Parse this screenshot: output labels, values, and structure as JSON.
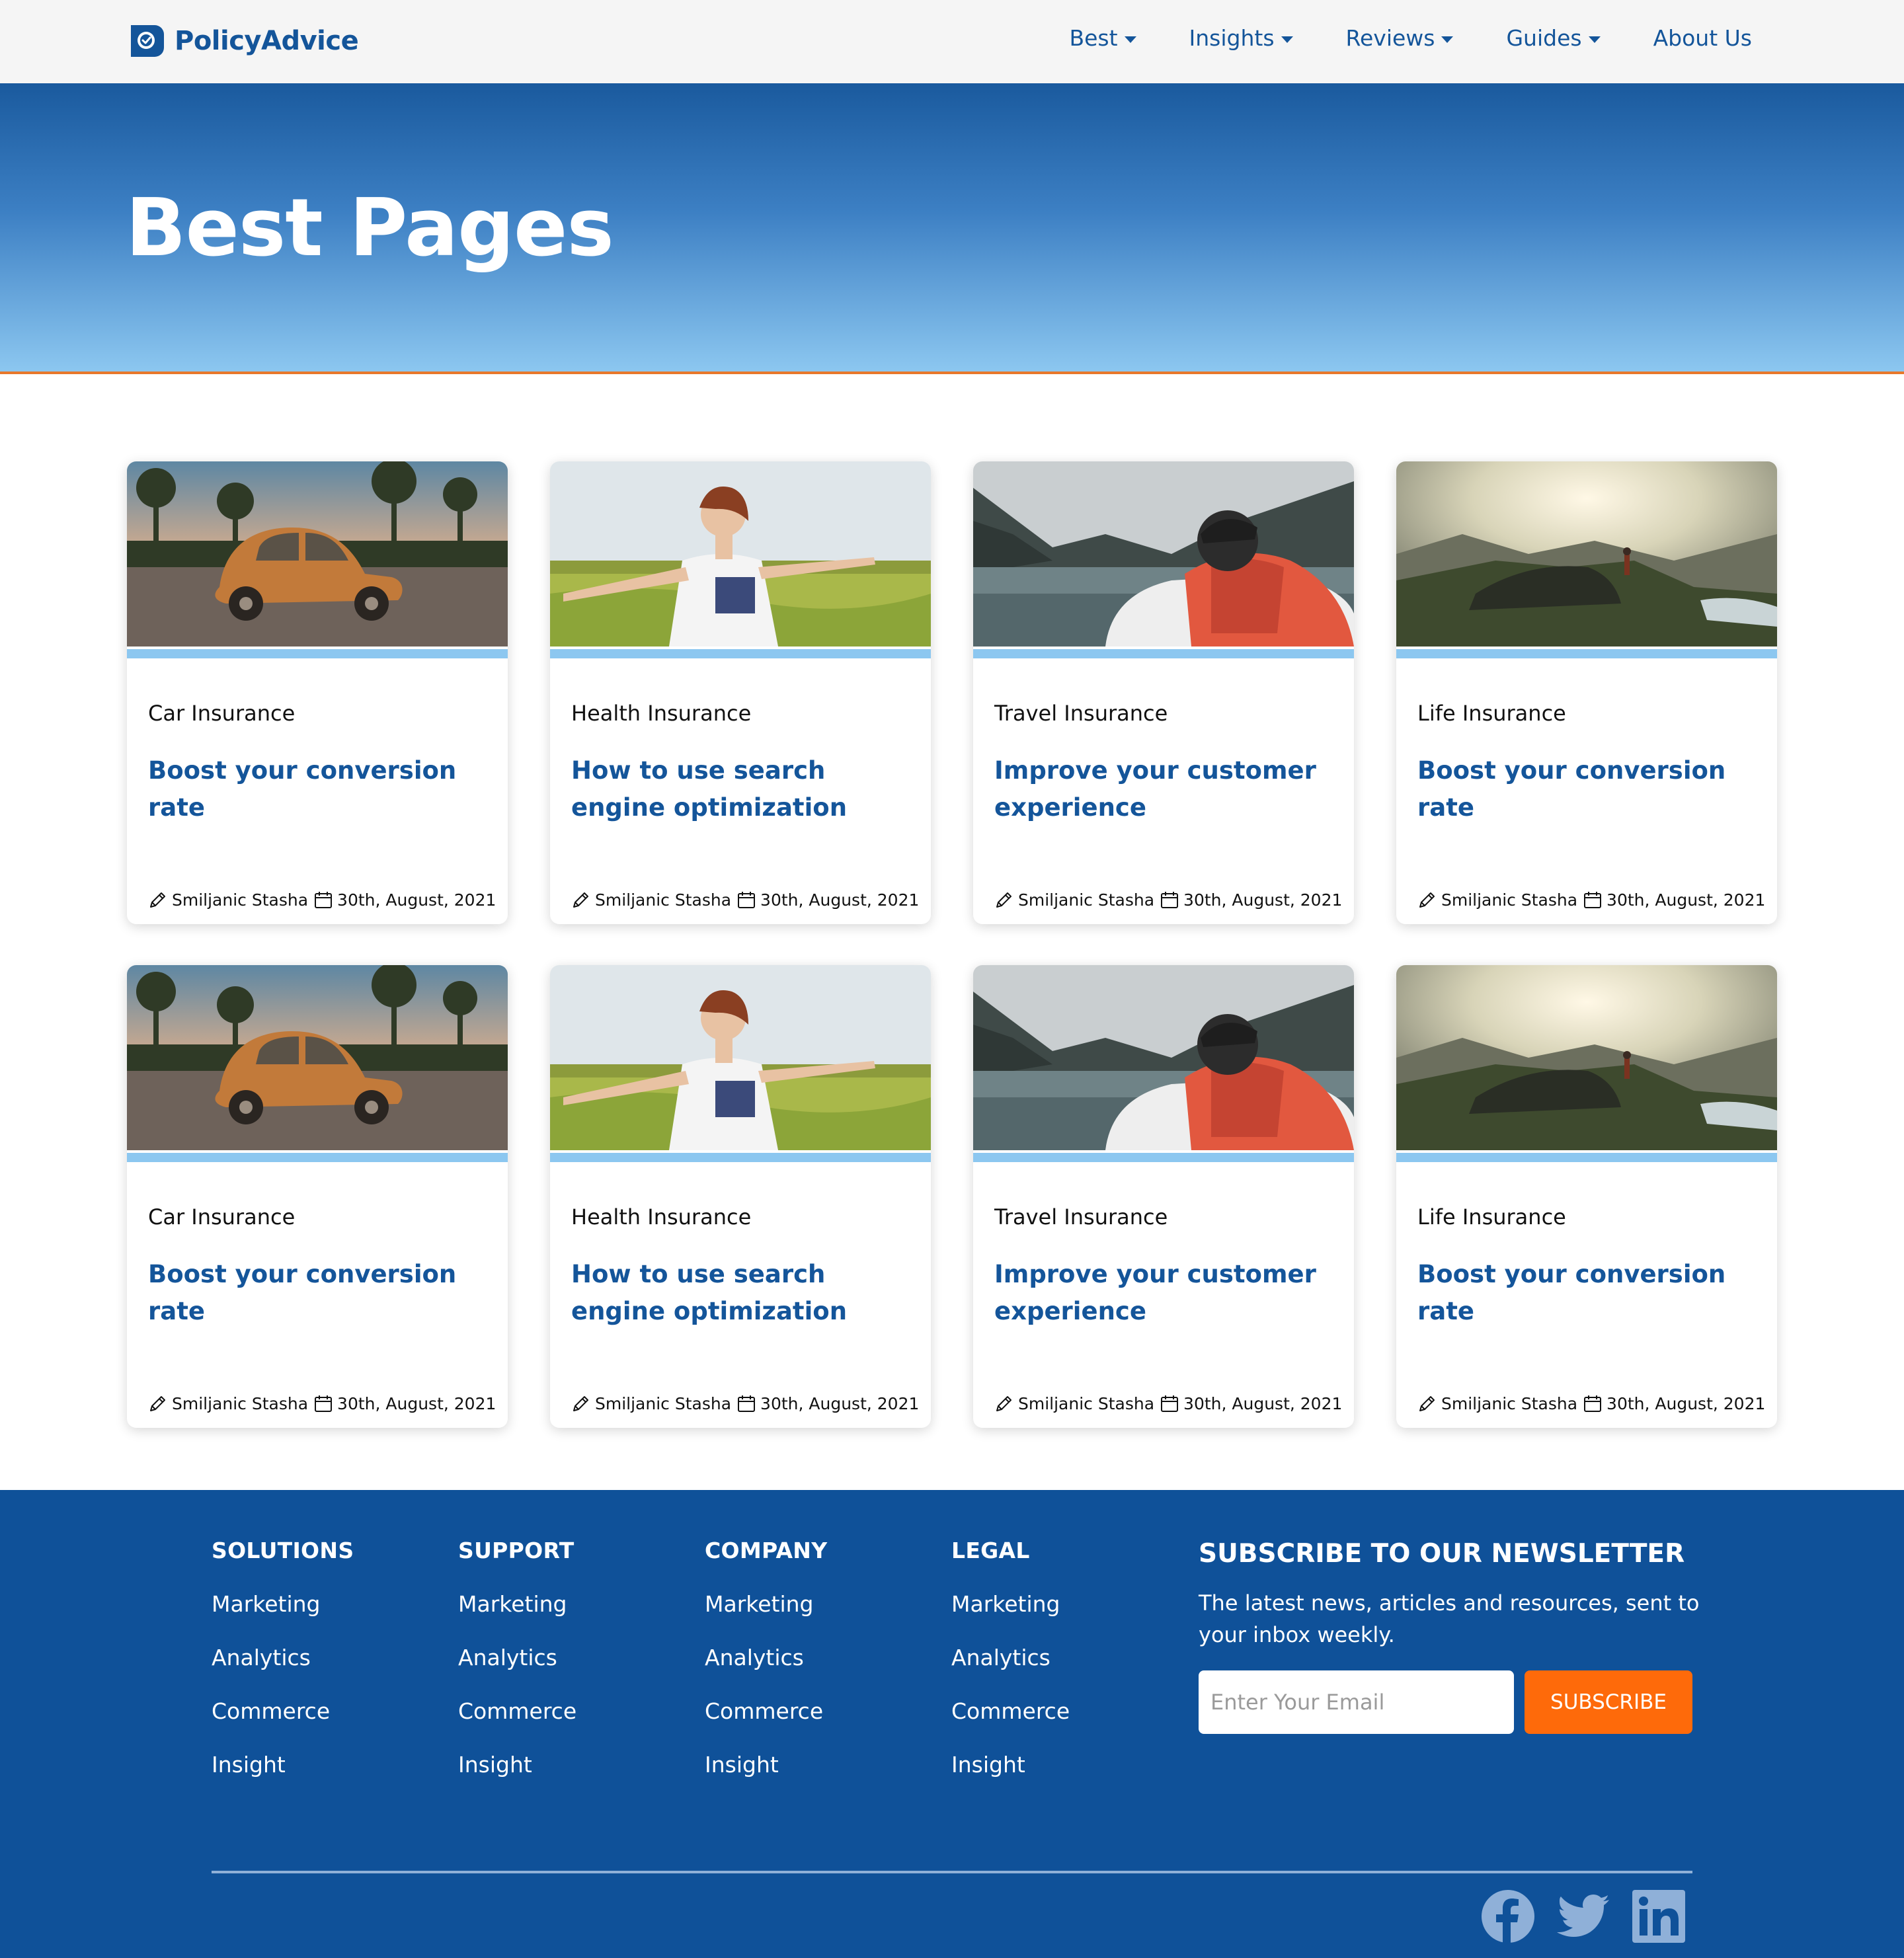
{
  "header": {
    "logo_text": "PolicyAdvice",
    "nav": [
      {
        "label": "Best",
        "dropdown": true
      },
      {
        "label": "Insights",
        "dropdown": true
      },
      {
        "label": "Reviews",
        "dropdown": true
      },
      {
        "label": "Guides",
        "dropdown": true
      },
      {
        "label": "About Us",
        "dropdown": false
      }
    ]
  },
  "hero": {
    "title": "Best Pages"
  },
  "cards": [
    {
      "category": "Car Insurance",
      "title": "Boost your conversion rate",
      "author": "Smiljanic Stasha",
      "date": "30th, August, 2021",
      "image": "car"
    },
    {
      "category": "Health Insurance",
      "title": "How to use search engine optimization",
      "author": "Smiljanic Stasha",
      "date": "30th, August, 2021",
      "image": "meadow"
    },
    {
      "category": "Travel Insurance",
      "title": "Improve your customer experience",
      "author": "Smiljanic Stasha",
      "date": "30th, August, 2021",
      "image": "lake"
    },
    {
      "category": "Life Insurance",
      "title": "Boost your conversion rate",
      "author": "Smiljanic Stasha",
      "date": "30th, August, 2021",
      "image": "mountain"
    },
    {
      "category": "Car Insurance",
      "title": "Boost your conversion rate",
      "author": "Smiljanic Stasha",
      "date": "30th, August, 2021",
      "image": "car"
    },
    {
      "category": "Health Insurance",
      "title": "How to use search engine optimization",
      "author": "Smiljanic Stasha",
      "date": "30th, August, 2021",
      "image": "meadow"
    },
    {
      "category": "Travel Insurance",
      "title": "Improve your customer experience",
      "author": "Smiljanic Stasha",
      "date": "30th, August, 2021",
      "image": "lake"
    },
    {
      "category": "Life Insurance",
      "title": "Boost your conversion rate",
      "author": "Smiljanic Stasha",
      "date": "30th, August, 2021",
      "image": "mountain"
    }
  ],
  "footer": {
    "columns": [
      {
        "heading": "SOLUTIONS",
        "links": [
          "Marketing",
          "Analytics",
          "Commerce",
          "Insight"
        ]
      },
      {
        "heading": "SUPPORT",
        "links": [
          "Marketing",
          "Analytics",
          "Commerce",
          "Insight"
        ]
      },
      {
        "heading": "COMPANY",
        "links": [
          "Marketing",
          "Analytics",
          "Commerce",
          "Insight"
        ]
      },
      {
        "heading": "LEGAL",
        "links": [
          "Marketing",
          "Analytics",
          "Commerce",
          "Insight"
        ]
      }
    ],
    "newsletter": {
      "heading": "SUBSCRIBE TO OUR NEWSLETTER",
      "text": "The latest news, articles and resources, sent to your inbox weekly.",
      "placeholder": "Enter Your Email",
      "button": "SUBSCRIBE"
    },
    "social": [
      "facebook-icon",
      "twitter-icon",
      "linkedin-icon"
    ]
  },
  "colors": {
    "brand_blue": "#14559a",
    "footer_blue": "#0f5199",
    "accent_orange": "#fe6a0a",
    "card_strip": "#8cc7f0"
  }
}
